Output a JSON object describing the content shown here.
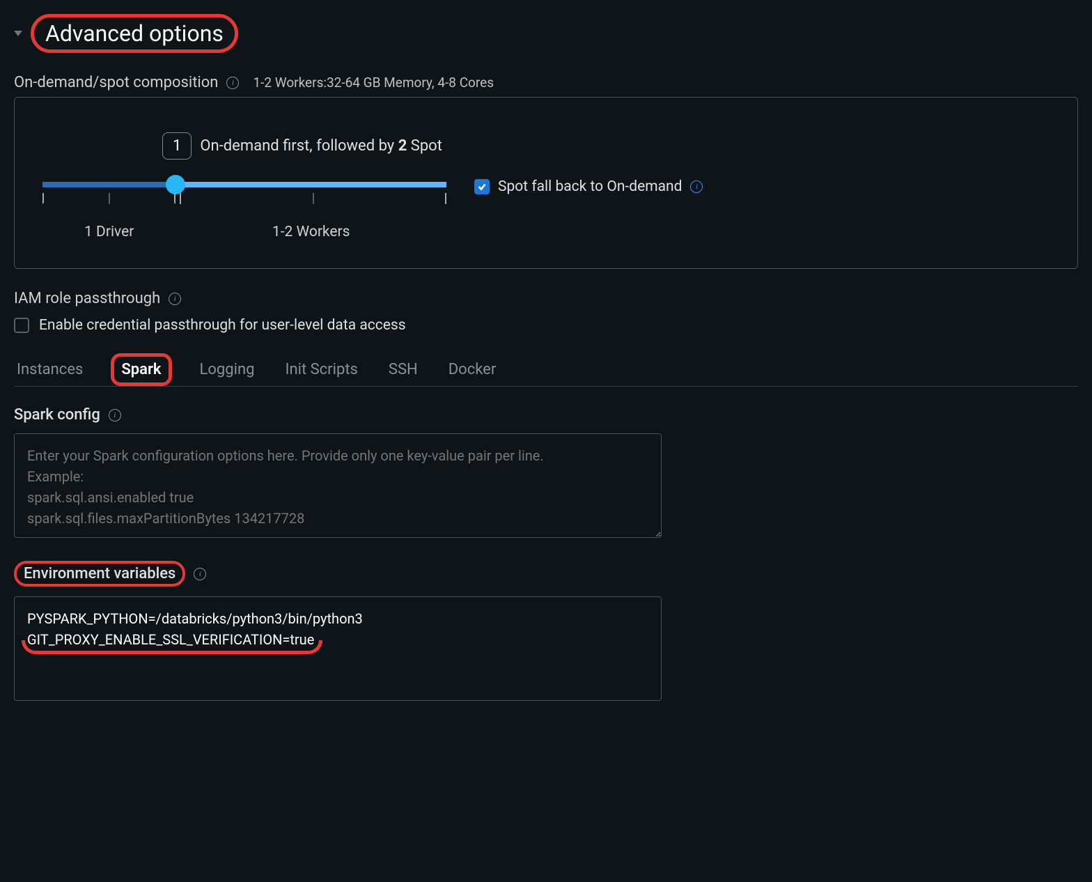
{
  "header": {
    "title": "Advanced options"
  },
  "composition": {
    "label": "On-demand/spot composition",
    "summary": "1-2 Workers:32-64 GB Memory, 4-8 Cores",
    "tooltip_value": "1",
    "tooltip_text_pre": "On-demand first, followed by ",
    "tooltip_text_num": "2",
    "tooltip_text_post": " Spot",
    "driver_label": "1 Driver",
    "workers_label": "1-2 Workers",
    "spot_fallback_label": "Spot fall back to On-demand",
    "spot_fallback_checked": true
  },
  "iam": {
    "label": "IAM role passthrough",
    "checkbox_label": "Enable credential passthrough for user-level data access",
    "checked": false
  },
  "tabs": {
    "items": [
      "Instances",
      "Spark",
      "Logging",
      "Init Scripts",
      "SSH",
      "Docker"
    ],
    "active": "Spark"
  },
  "spark_config": {
    "label": "Spark config",
    "placeholder": "Enter your Spark configuration options here. Provide only one key-value pair per line.\nExample:\nspark.sql.ansi.enabled true\nspark.sql.files.maxPartitionBytes 134217728"
  },
  "env_vars": {
    "label": "Environment variables",
    "line1": "PYSPARK_PYTHON=/databricks/python3/bin/python3",
    "line2": "GIT_PROXY_ENABLE_SSL_VERIFICATION=true"
  }
}
